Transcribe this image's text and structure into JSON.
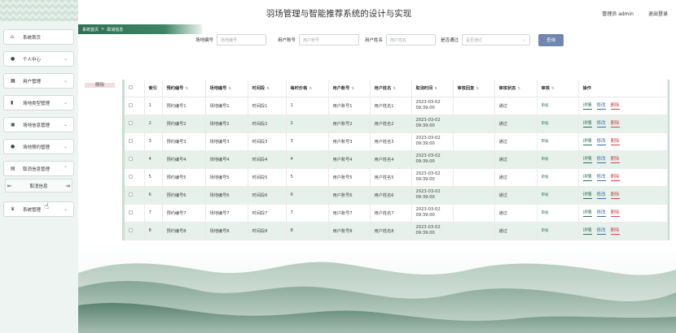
{
  "header": {
    "title": "羽场管理与智能推荐系统的设计与实现",
    "user": "管理员 admin",
    "logout": "退出登录"
  },
  "breadcrumb": {
    "home": "系统首页",
    "sep": ">",
    "current": "取消信息"
  },
  "sidebar": {
    "items": [
      {
        "label": "系统首页",
        "icon": "home-icon"
      },
      {
        "label": "个人中心",
        "icon": "user-icon"
      },
      {
        "label": "用户管理",
        "icon": "grid-icon"
      },
      {
        "label": "场地类型管理",
        "icon": "chart-icon"
      },
      {
        "label": "场地信息管理",
        "icon": "briefcase-icon"
      },
      {
        "label": "场地预约管理",
        "icon": "user-icon"
      },
      {
        "label": "取消信息管理",
        "icon": "table-icon"
      },
      {
        "label": "系统管理",
        "icon": "trophy-icon"
      }
    ],
    "sub_item": "取消信息"
  },
  "search": {
    "fields": [
      {
        "label": "场地编号",
        "placeholder": "场地编号"
      },
      {
        "label": "用户账号",
        "placeholder": "用户账号"
      },
      {
        "label": "用户姓名",
        "placeholder": "用户姓名"
      }
    ],
    "select_label": "是否通过",
    "select_placeholder": "是否通过",
    "button": "查询"
  },
  "delete_button": "删除",
  "table": {
    "headers": [
      "索引",
      "预约编号",
      "场地编号",
      "时间段",
      "每时价格",
      "用户账号",
      "用户姓名",
      "取消时间",
      "审核回复",
      "审核状态",
      "审核",
      "操作"
    ],
    "rows": [
      {
        "idx": "1",
        "booking": "预约编号1",
        "venue": "场地编号1",
        "slot": "时间段1",
        "price": "1",
        "account": "用户账号1",
        "name": "用户姓名1",
        "date": "2023-03-02",
        "time": "09:39:00",
        "reply": "",
        "status": "通过",
        "audit": "审核"
      },
      {
        "idx": "2",
        "booking": "预约编号2",
        "venue": "场地编号2",
        "slot": "时间段2",
        "price": "2",
        "account": "用户账号2",
        "name": "用户姓名2",
        "date": "2023-03-02",
        "time": "09:39:00",
        "reply": "",
        "status": "通过",
        "audit": "审核"
      },
      {
        "idx": "3",
        "booking": "预约编号3",
        "venue": "场地编号3",
        "slot": "时间段3",
        "price": "3",
        "account": "用户账号3",
        "name": "用户姓名3",
        "date": "2023-03-02",
        "time": "09:39:00",
        "reply": "",
        "status": "通过",
        "audit": "审核"
      },
      {
        "idx": "4",
        "booking": "预约编号4",
        "venue": "场地编号4",
        "slot": "时间段4",
        "price": "4",
        "account": "用户账号4",
        "name": "用户姓名4",
        "date": "2023-03-02",
        "time": "09:39:00",
        "reply": "",
        "status": "通过",
        "audit": "审核"
      },
      {
        "idx": "5",
        "booking": "预约编号5",
        "venue": "场地编号5",
        "slot": "时间段5",
        "price": "5",
        "account": "用户账号5",
        "name": "用户姓名5",
        "date": "2023-03-02",
        "time": "09:39:00",
        "reply": "",
        "status": "通过",
        "audit": "审核"
      },
      {
        "idx": "6",
        "booking": "预约编号6",
        "venue": "场地编号6",
        "slot": "时间段6",
        "price": "6",
        "account": "用户账号6",
        "name": "用户姓名6",
        "date": "2023-03-02",
        "time": "09:39:00",
        "reply": "",
        "status": "通过",
        "audit": "审核"
      },
      {
        "idx": "7",
        "booking": "预约编号7",
        "venue": "场地编号7",
        "slot": "时间段7",
        "price": "7",
        "account": "用户账号7",
        "name": "用户姓名7",
        "date": "2023-03-02",
        "time": "09:39:00",
        "reply": "",
        "status": "通过",
        "audit": "审核"
      },
      {
        "idx": "8",
        "booking": "预约编号8",
        "venue": "场地编号8",
        "slot": "时间段8",
        "price": "8",
        "account": "用户账号8",
        "name": "用户姓名8",
        "date": "2023-03-02",
        "time": "09:39:00",
        "reply": "",
        "status": "通过",
        "audit": "审核"
      }
    ],
    "actions": {
      "detail": "详情",
      "edit": "修改",
      "delete": "删除"
    }
  },
  "colors": {
    "primary": "#2f6f55",
    "query_button": "#6f86b0",
    "row_alt": "#e6f1eb"
  }
}
